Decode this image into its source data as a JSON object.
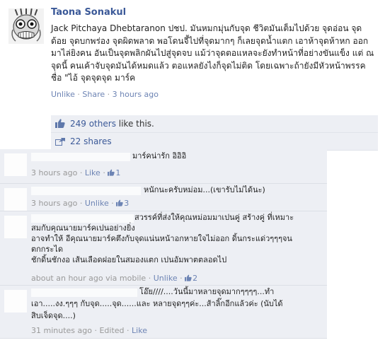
{
  "post": {
    "author": "Taona Sonakul",
    "text": "Jack Pitchaya Dhebtaranon ปชป. มันหมกมุ่นกับจุด ชีวิตมันเต็มไปด้วย จุดอ่อน จุดด้อย จุดบกพร่อง จุดผิดพลาด พอโดนจี้ไปที่จุดมากๆ ก็เลยจุดน้ำแตก เอาห้าจุดห้าหก ออกมาไล่ยิงคน อันเป็นจุดพลิกผันไปสู่จุดจบ แม้ว่าจุดตอแหลจะยังทำหน้าที่อย่างขันแข็ง แต่ ณ จุดนี้ คนเค้าจับจุดมันได้หมดแล้ว ตอแหลยังไงก็จุดไม่ติด โดยเฉพาะถ้ายังมีหัวหน้าพรรคชื่อ \"ไอ้ จุดจุดจุด มาร์ค",
    "unlike_label": "Unlike",
    "share_label": "Share",
    "sep": "·",
    "time": "3 hours ago"
  },
  "likes": {
    "count_text": "249 others",
    "suffix": " like this."
  },
  "shares": {
    "text": "22 shares"
  },
  "comments": [
    {
      "text": "มาร์คน่ารัก อิอิอิ",
      "time": "3 hours ago",
      "action": "Like",
      "likes": "1"
    },
    {
      "text": "หนักนะครับหม่อม...(เขารับไม่ได้นะ)",
      "time": "3 hours ago",
      "action": "Unlike",
      "likes": "3"
    },
    {
      "lines": [
        "สวรรค์ที่ส่งให้คุณหม่อมมาเปนคู่ สร้างคู่ ที่เหมาะ",
        "สมกับคุณนายมาร์คเปนอย่างยิ่ง",
        "อาจทำให้ อีคุณนายมาร์คตึงกับจุดแน่นหน้าอกหายใจไม่ออก ดิ้นกระแด่วๆๆๆจน",
        "ตกกระได",
        "ชักดิ้นชักงอ เส้นเลือดฝอยในสมองแตก เปนอัมพาตตลอดไป"
      ],
      "time": "about an hour ago via mobile",
      "action": "Unlike",
      "likes": "2"
    },
    {
      "lines": [
        "โอ๊ย////....วันนี้มาหลายจุดมากๆๆๆๆ...ทำ",
        "เอา.....งง.ๆๆๆ กับจุด.....จุด......และ หลายจุดๆๆค่ะ...ส้าลิ๊กอีกแล้วค่ะ (นับได้",
        "สิบเจ็ดจุด....)"
      ],
      "time": "31 minutes ago",
      "edited": "Edited",
      "action": "Like"
    }
  ],
  "colors": {
    "link": "#3b5998",
    "muted": "#999999",
    "panel": "#edeff4"
  },
  "icons": {
    "like": "thumbs-up-icon",
    "share": "share-icon"
  }
}
